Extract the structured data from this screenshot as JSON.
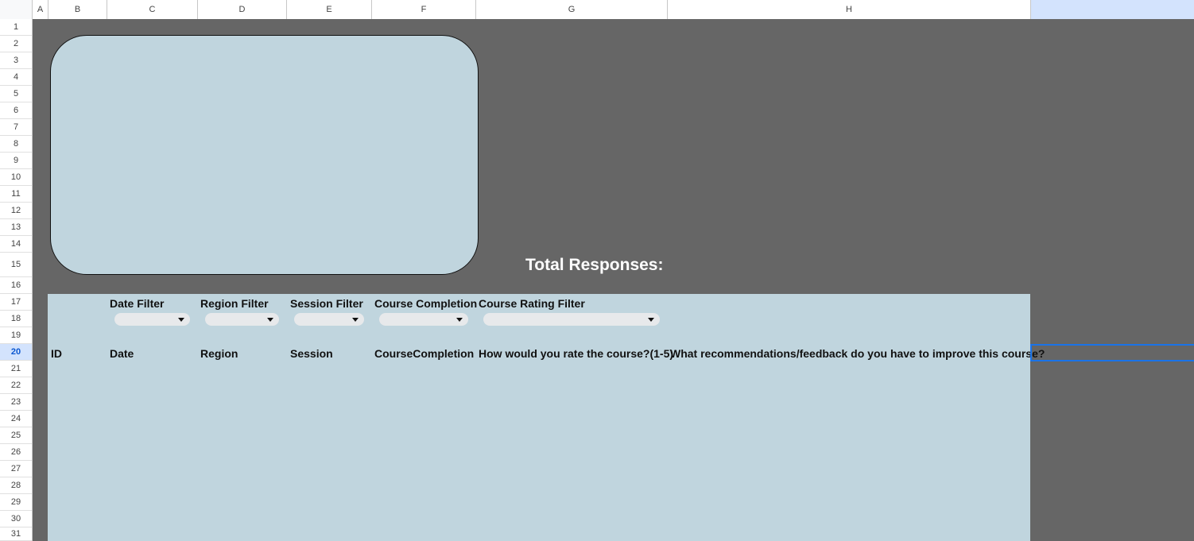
{
  "columns": [
    "A",
    "B",
    "C",
    "D",
    "E",
    "F",
    "G",
    "H"
  ],
  "rows": [
    "1",
    "2",
    "3",
    "4",
    "5",
    "6",
    "7",
    "8",
    "9",
    "10",
    "11",
    "12",
    "13",
    "14",
    "15",
    "16",
    "17",
    "18",
    "19",
    "20",
    "21",
    "22",
    "23",
    "24",
    "25",
    "26",
    "27",
    "28",
    "29",
    "30",
    "31"
  ],
  "selected_row": "20",
  "total_responses_label": "Total Responses:",
  "filters": {
    "date_filter": "Date Filter",
    "region_filter": "Region Filter",
    "session_filter": "Session Filter",
    "course_completion": "Course Completion",
    "course_rating_filter": "Course Rating Filter"
  },
  "table_headers": {
    "id": "ID",
    "date": "Date",
    "region": "Region",
    "session": "Session",
    "course_completion": "CourseCompletion",
    "rating": "How would you rate the course?(1-5)",
    "feedback": "What recommendations/feedback do you have to improve this course?"
  },
  "colors": {
    "sheet_background": "#666666",
    "panel_fill": "#c0d5de",
    "selection_blue": "#1a73e8"
  },
  "icons": {
    "dropdown": "caret-down-icon"
  }
}
